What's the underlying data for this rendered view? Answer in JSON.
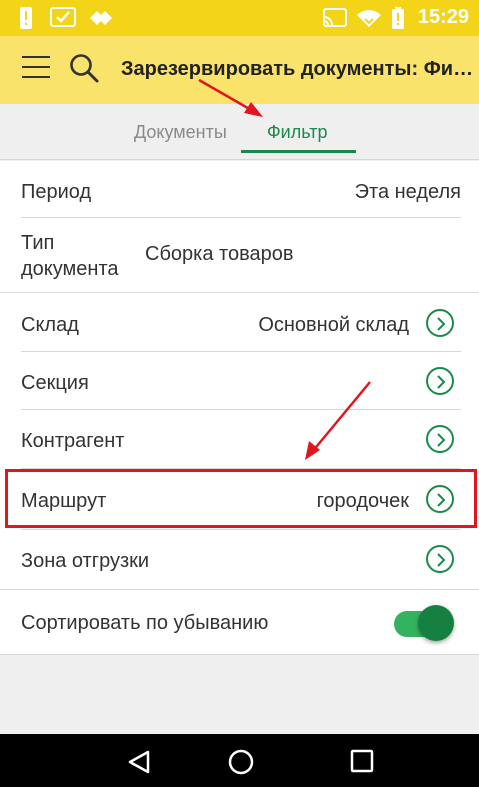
{
  "status_bar": {
    "time": "15:29",
    "icons": [
      "alert-icon",
      "check-icon",
      "diamond-icon",
      "cast-icon",
      "wifi-icon",
      "battery-icon"
    ]
  },
  "app_bar": {
    "title": "Зарезервировать документы: Фильтр",
    "icons": [
      "menu-icon",
      "search-icon"
    ]
  },
  "tabs": [
    {
      "label": "Документы",
      "active": false
    },
    {
      "label": "Фильтр",
      "active": true
    }
  ],
  "filter": {
    "period": {
      "label": "Период",
      "value": "Эта неделя"
    },
    "doc_type": {
      "label_line1": "Тип",
      "label_line2": "документа",
      "value": "Сборка товаров"
    },
    "warehouse": {
      "label": "Склад",
      "value": "Основной склад"
    },
    "section": {
      "label": "Секция",
      "value": ""
    },
    "counterparty": {
      "label": "Контрагент",
      "value": ""
    },
    "route": {
      "label": "Маршрут",
      "value": "городочек"
    },
    "shipping_zone": {
      "label": "Зона отгрузки",
      "value": ""
    },
    "sort_desc": {
      "label": "Сортировать по убыванию",
      "enabled": true
    }
  },
  "nav_bar": {
    "icons": [
      "back-icon",
      "home-icon",
      "recents-icon"
    ]
  },
  "colors": {
    "status_bar": "#f3d418",
    "app_bar": "#fae36a",
    "accent_green": "#1a8a4a",
    "annotation_red": "#e0151d"
  }
}
